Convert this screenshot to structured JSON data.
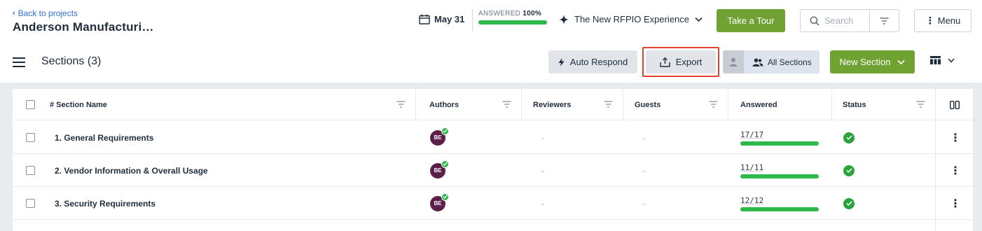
{
  "header": {
    "back_link": "Back to projects",
    "project_title": "Anderson Manufacturi…",
    "due_date": "May 31",
    "answered_label": "ANSWERED",
    "answered_percent_text": "100%",
    "answered_fraction": 1.0,
    "project_selector": "The New RFPIO Experience",
    "tour_button": "Take a Tour",
    "search_placeholder": "Search",
    "menu_button": "Menu"
  },
  "toolbar": {
    "sections_title": "Sections (3)",
    "auto_respond": "Auto Respond",
    "export": "Export",
    "all_sections": "All Sections",
    "new_section": "New Section"
  },
  "table": {
    "columns": {
      "section_name": "# Section Name",
      "authors": "Authors",
      "reviewers": "Reviewers",
      "guests": "Guests",
      "answered": "Answered",
      "status": "Status"
    },
    "rows": [
      {
        "name": "1. General Requirements",
        "author_initials": "BE",
        "reviewers": "-",
        "guests": "-",
        "answered": "17/17",
        "answered_fraction": 1.0,
        "status": "complete"
      },
      {
        "name": "2. Vendor Information & Overall Usage",
        "author_initials": "BE",
        "reviewers": "-",
        "guests": "-",
        "answered": "11/11",
        "answered_fraction": 1.0,
        "status": "complete"
      },
      {
        "name": "3. Security Requirements",
        "author_initials": "BE",
        "reviewers": "-",
        "guests": "-",
        "answered": "12/12",
        "answered_fraction": 1.0,
        "status": "complete"
      }
    ]
  },
  "colors": {
    "accent_green": "#6fa232",
    "progress_green": "#2db84c",
    "link_blue": "#2f6fd6",
    "highlight_red": "#e0412c",
    "avatar_purple": "#5b1f4a"
  },
  "icons": {
    "back": "chevron-left-icon",
    "calendar": "calendar-icon",
    "project": "diamond-star-icon",
    "search": "search-icon",
    "filter": "filter-icon",
    "menu": "vertical-dots-icon",
    "auto_respond": "lightning-icon",
    "export": "upload-icon",
    "users": "users-icon",
    "columns": "table-columns-icon",
    "status": "check-circle-icon"
  }
}
